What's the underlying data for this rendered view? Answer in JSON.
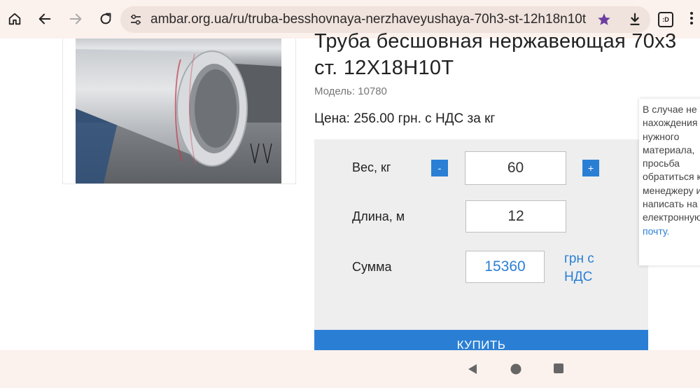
{
  "browser": {
    "url": "ambar.org.ua/ru/truba-besshovnaya-nerzhaveyushaya-70h3-st-12h18n10t",
    "tab_count": ":D"
  },
  "product": {
    "title": "Труба бесшовная нержавеющая 70х3 ст. 12Х18Н10Т",
    "model": "Модель: 10780",
    "price": "Цена: 256.00 грн. с НДС за кг"
  },
  "calculator": {
    "weight_label": "Вес, кг",
    "weight_value": "60",
    "minus_label": "-",
    "plus_label": "+",
    "length_label": "Длина, м",
    "length_value": "12",
    "sum_label": "Сумма",
    "sum_value": "15360",
    "currency": "грн с НДС",
    "buy_label": "КУПИТЬ"
  },
  "note": {
    "text": "В случае не нахождения нужного материала, просьба обратиться к менеджеру или написать на електронную",
    "link": "почту."
  },
  "colors": {
    "accent": "#2a7fd4",
    "panel_bg": "#eeeeee",
    "chrome_bg": "#fbf1ed"
  },
  "icons": [
    "home-icon",
    "back-arrow-icon",
    "forward-arrow-icon",
    "reload-icon",
    "site-settings-icon",
    "star-icon",
    "download-icon",
    "tab-switcher-icon",
    "more-menu-icon",
    "nav-back-icon",
    "nav-home-icon",
    "nav-recents-icon"
  ]
}
